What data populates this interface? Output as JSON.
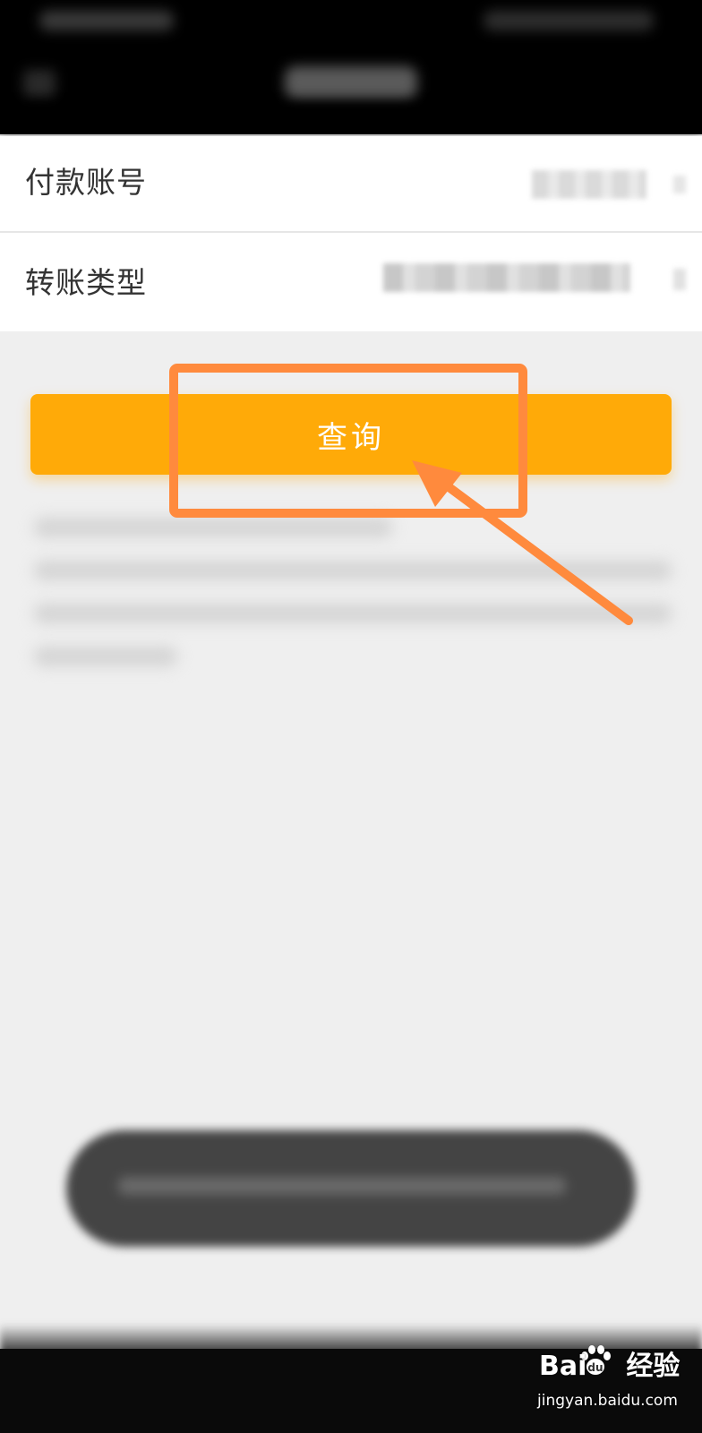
{
  "form": {
    "rows": [
      {
        "label": "付款账号"
      },
      {
        "label": "转账类型"
      }
    ]
  },
  "actions": {
    "query_label": "查询"
  },
  "watermark": {
    "brand": "Bai",
    "brand_cn": "经验",
    "url": "jingyan.baidu.com"
  },
  "colors": {
    "accent": "#ffaa08",
    "annotation": "#ff8a3d",
    "topbar": "#000000",
    "background": "#efefef"
  },
  "icons": [
    "paw-icon",
    "annotation-arrow-icon"
  ]
}
